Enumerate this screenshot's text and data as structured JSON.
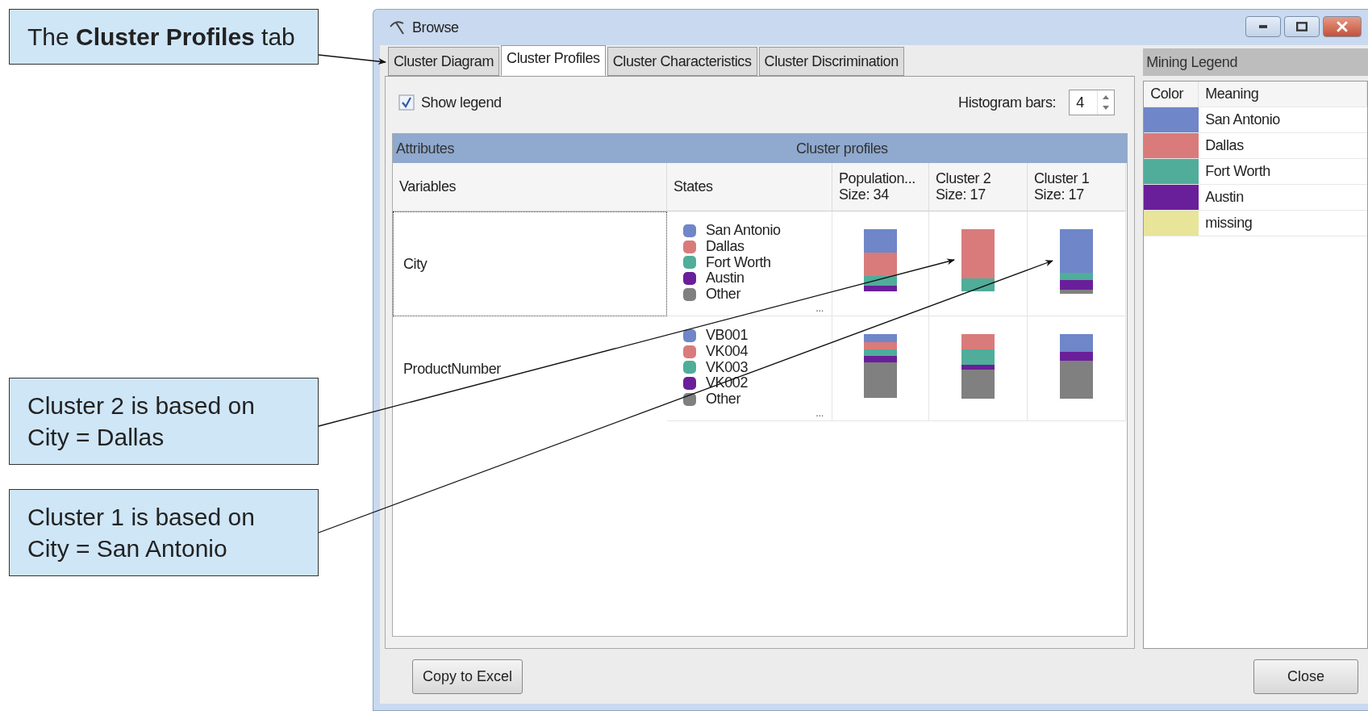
{
  "callouts": [
    {
      "text": "The **Cluster Profiles** tab"
    },
    {
      "text": "Cluster 2 is based on City = Dallas"
    },
    {
      "text": "Cluster 1 is based on City = San Antonio"
    }
  ],
  "window": {
    "title": "Browse"
  },
  "tabs": [
    {
      "label": "Cluster Diagram",
      "selected": false
    },
    {
      "label": "Cluster Profiles",
      "selected": true
    },
    {
      "label": "Cluster Characteristics",
      "selected": false
    },
    {
      "label": "Cluster Discrimination",
      "selected": false
    }
  ],
  "show_legend": {
    "label": "Show legend",
    "checked": true
  },
  "histogram_bars": {
    "label": "Histogram bars:",
    "value": "4"
  },
  "grid": {
    "band": [
      "Attributes",
      "Cluster profiles"
    ],
    "columns": [
      {
        "label": "Variables"
      },
      {
        "label": "States"
      },
      {
        "label": "Population...",
        "size": "Size: 34"
      },
      {
        "label": "Cluster 2",
        "size": "Size: 17"
      },
      {
        "label": "Cluster 1",
        "size": "Size: 17"
      }
    ],
    "rows": [
      {
        "variable": "City",
        "focused": true,
        "more": "...",
        "states": [
          {
            "label": "San Antonio",
            "color": "#6f86c8"
          },
          {
            "label": "Dallas",
            "color": "#d97b7b"
          },
          {
            "label": "Fort Worth",
            "color": "#4fad9a"
          },
          {
            "label": "Austin",
            "color": "#6a1f9a"
          },
          {
            "label": "Other",
            "color": "#808080"
          }
        ],
        "histograms": [
          {
            "segments": [
              {
                "color": "#6f86c8"
              },
              {
                "color": "#d97b7b"
              },
              {
                "color": "#4fad9a"
              },
              {
                "color": "#6a1f9a"
              }
            ]
          },
          {
            "segments": [
              {
                "color": "#d97b7b"
              },
              {
                "color": "#4fad9a"
              }
            ]
          },
          {
            "segments": [
              {
                "color": "#6f86c8"
              },
              {
                "color": "#4fad9a"
              },
              {
                "color": "#6a1f9a"
              },
              {
                "color": "#808080"
              }
            ]
          }
        ]
      },
      {
        "variable": "ProductNumber",
        "focused": false,
        "more": "...",
        "states": [
          {
            "label": "VB001",
            "color": "#6f86c8"
          },
          {
            "label": "VK004",
            "color": "#d97b7b"
          },
          {
            "label": "VK003",
            "color": "#4fad9a"
          },
          {
            "label": "VK002",
            "color": "#6a1f9a"
          },
          {
            "label": "Other",
            "color": "#808080"
          }
        ],
        "histograms": [
          {
            "segments": [
              {
                "color": "#6f86c8"
              },
              {
                "color": "#d97b7b"
              },
              {
                "color": "#4fad9a"
              },
              {
                "color": "#6a1f9a"
              },
              {
                "color": "#808080"
              }
            ]
          },
          {
            "segments": [
              {
                "color": "#d97b7b"
              },
              {
                "color": "#4fad9a"
              },
              {
                "color": "#6a1f9a"
              },
              {
                "color": "#808080"
              }
            ]
          },
          {
            "segments": [
              {
                "color": "#6f86c8"
              },
              {
                "color": "#6a1f9a"
              },
              {
                "color": "#808080"
              }
            ]
          }
        ]
      }
    ]
  },
  "legend": {
    "title": "Mining Legend",
    "columns": [
      "Color",
      "Meaning"
    ],
    "items": [
      {
        "meaning": "San Antonio",
        "color": "#6f86c8"
      },
      {
        "meaning": "Dallas",
        "color": "#d97b7b"
      },
      {
        "meaning": "Fort Worth",
        "color": "#4fad9a"
      },
      {
        "meaning": "Austin",
        "color": "#6a1f9a"
      },
      {
        "meaning": "missing",
        "color": "#e8e49a"
      }
    ]
  },
  "buttons": [
    {
      "label": "Copy to Excel"
    },
    {
      "label": "Close"
    }
  ]
}
